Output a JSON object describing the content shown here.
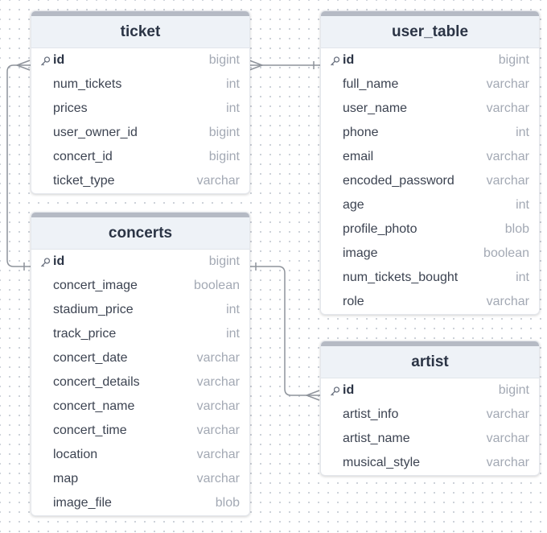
{
  "tables": {
    "ticket": {
      "name": "ticket",
      "columns": [
        {
          "name": "id",
          "type": "bigint",
          "pk": true
        },
        {
          "name": "num_tickets",
          "type": "int"
        },
        {
          "name": "prices",
          "type": "int"
        },
        {
          "name": "user_owner_id",
          "type": "bigint"
        },
        {
          "name": "concert_id",
          "type": "bigint"
        },
        {
          "name": "ticket_type",
          "type": "varchar"
        }
      ]
    },
    "user_table": {
      "name": "user_table",
      "columns": [
        {
          "name": "id",
          "type": "bigint",
          "pk": true
        },
        {
          "name": "full_name",
          "type": "varchar"
        },
        {
          "name": "user_name",
          "type": "varchar"
        },
        {
          "name": "phone",
          "type": "int"
        },
        {
          "name": "email",
          "type": "varchar"
        },
        {
          "name": "encoded_password",
          "type": "varchar"
        },
        {
          "name": "age",
          "type": "int"
        },
        {
          "name": "profile_photo",
          "type": "blob"
        },
        {
          "name": "image",
          "type": "boolean"
        },
        {
          "name": "num_tickets_bought",
          "type": "int"
        },
        {
          "name": "role",
          "type": "varchar"
        }
      ]
    },
    "concerts": {
      "name": "concerts",
      "columns": [
        {
          "name": "id",
          "type": "bigint",
          "pk": true
        },
        {
          "name": "concert_image",
          "type": "boolean"
        },
        {
          "name": "stadium_price",
          "type": "int"
        },
        {
          "name": "track_price",
          "type": "int"
        },
        {
          "name": "concert_date",
          "type": "varchar"
        },
        {
          "name": "concert_details",
          "type": "varchar"
        },
        {
          "name": "concert_name",
          "type": "varchar"
        },
        {
          "name": "concert_time",
          "type": "varchar"
        },
        {
          "name": "location",
          "type": "varchar"
        },
        {
          "name": "map",
          "type": "varchar"
        },
        {
          "name": "image_file",
          "type": "blob"
        }
      ]
    },
    "artist": {
      "name": "artist",
      "columns": [
        {
          "name": "id",
          "type": "bigint",
          "pk": true
        },
        {
          "name": "artist_info",
          "type": "varchar"
        },
        {
          "name": "artist_name",
          "type": "varchar"
        },
        {
          "name": "musical_style",
          "type": "varchar"
        }
      ]
    }
  },
  "relationships": [
    {
      "from": "ticket.id",
      "to": "user_table.id",
      "from_end": "many",
      "to_end": "one"
    },
    {
      "from": "ticket.id",
      "to": "concerts.id",
      "from_end": "many",
      "to_end": "one"
    },
    {
      "from": "concerts.id",
      "to": "artist.id",
      "from_end": "one",
      "to_end": "many"
    }
  ],
  "colors": {
    "header_bar": "#b5bac4",
    "header_bg": "#eef2f7",
    "connector": "#8e939b",
    "type_text": "#a3a9b4"
  }
}
